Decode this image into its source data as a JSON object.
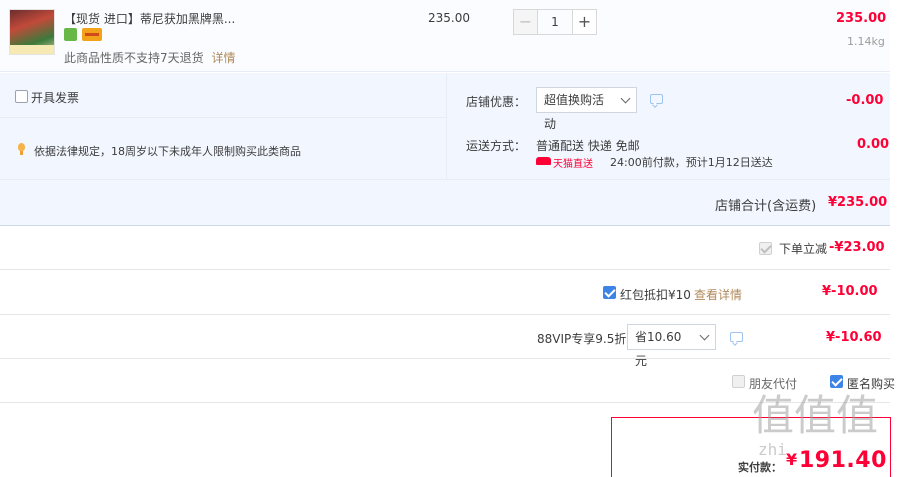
{
  "product": {
    "title": "【现货 进口】蒂尼获加黑牌黑...",
    "unit_price": "235.00",
    "quantity": "1",
    "minus": "−",
    "plus": "+",
    "subtotal": "235.00",
    "weight": "1.14kg",
    "return_notice": "此商品性质不支持7天退货",
    "details_link": "详情"
  },
  "shop": {
    "invoice_label": "开具发票",
    "promo_label": "店铺优惠：",
    "promo_select": "超值换购活动",
    "promo_amount": "-0.00",
    "law_notice": "依据法律规定，18周岁以下未成年人限制购买此类商品",
    "shipping_label": "运送方式：",
    "shipping_method": "普通配送 快递 免邮",
    "shipping_fee": "0.00",
    "tmall_tag": "天猫直送",
    "delivery_note": "24:00前付款，预计1月12日送达",
    "total_label": "店铺合计(含运费)",
    "total_amount": "¥235.00"
  },
  "discounts": {
    "instant_label": "下单立减",
    "instant_amount": "-¥23.00",
    "redpacket_label": "红包抵扣¥10",
    "redpacket_link": "查看详情",
    "redpacket_amount": "¥-10.00",
    "vip_label": "88VIP专享9.5折",
    "vip_select": "省10.60元",
    "vip_amount": "¥-10.60"
  },
  "options": {
    "friend_pay": "朋友代付",
    "anonymous": "匿名购买"
  },
  "final": {
    "pay_label": "实付款：",
    "currency": "¥",
    "amount": "191.40"
  },
  "watermark": {
    "text": "值值值",
    "site": "zhi"
  },
  "colors": {
    "accent_red": "#ff0036",
    "checkbox_blue": "#3d84e6",
    "panel_bg": "#f2f7ff",
    "link_brown": "#b08a5b"
  }
}
